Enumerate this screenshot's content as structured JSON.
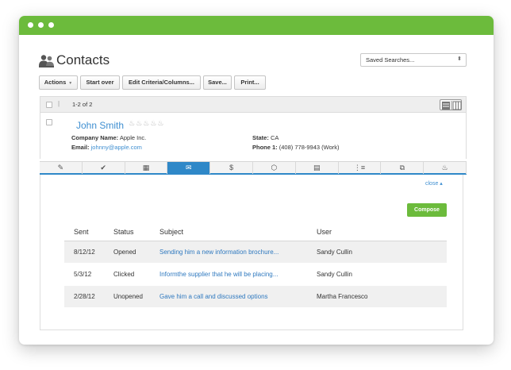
{
  "page": {
    "title": "Contacts"
  },
  "saved_searches": {
    "value": "Saved Searches..."
  },
  "toolbar": {
    "actions": "Actions",
    "start_over": "Start over",
    "edit_criteria": "Edit Criteria/Columns...",
    "save": "Save...",
    "print": "Print..."
  },
  "results": {
    "count": "1-2 of 2"
  },
  "contact": {
    "name": "John Smith",
    "company_label": "Company Name:",
    "company": "Apple Inc.",
    "email_label": "Email:",
    "email": "johnny@apple.com",
    "state_label": "State:",
    "state": "CA",
    "phone_label": "Phone 1:",
    "phone": "(408) 778-9943 (Work)",
    "rating_icons": "flame-icon x5"
  },
  "tabs": [
    {
      "icon": "edit-icon",
      "glyph": "✎"
    },
    {
      "icon": "checkmark-icon",
      "glyph": "✔"
    },
    {
      "icon": "calendar-icon",
      "glyph": "▦"
    },
    {
      "icon": "email-icon",
      "glyph": "✉",
      "active": true
    },
    {
      "icon": "dollar-icon",
      "glyph": "$"
    },
    {
      "icon": "tag-icon",
      "glyph": "⬡"
    },
    {
      "icon": "notes-icon",
      "glyph": "▤"
    },
    {
      "icon": "list-icon",
      "glyph": "⋮≡"
    },
    {
      "icon": "windows-icon",
      "glyph": "⧉"
    },
    {
      "icon": "flame-icon",
      "glyph": "♨"
    }
  ],
  "panel": {
    "close": "close ▴",
    "compose": "Compose"
  },
  "table": {
    "headers": [
      "Sent",
      "Status",
      "Subject",
      "User"
    ],
    "rows": [
      {
        "sent": "8/12/12",
        "status": "Opened",
        "subject": "Sending him a new information brochure...",
        "user": "Sandy Cullin"
      },
      {
        "sent": "5/3/12",
        "status": "Clicked",
        "subject": "Informthe supplier that he will be placing...",
        "user": "Sandy Cullin"
      },
      {
        "sent": "2/28/12",
        "status": "Unopened",
        "subject": "Gave him a call and discussed options",
        "user": "Martha Francesco"
      }
    ]
  },
  "colors": {
    "brand_green": "#6cbb3c",
    "accent_blue": "#2f88c8",
    "link_blue": "#3f8fd1"
  }
}
